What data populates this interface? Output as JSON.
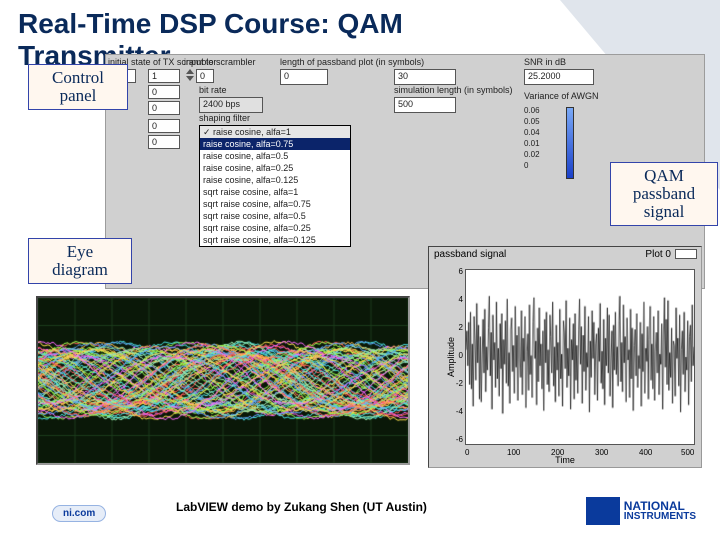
{
  "domain": "Document",
  "slide": {
    "title_line1": "Real-Time DSP Course: QAM",
    "title_line2": "Transmitter"
  },
  "annotations": {
    "control": "Control\npanel",
    "qam": "QAM\npassband\nsignal",
    "eye": "Eye\ndiagram"
  },
  "panel": {
    "headers": {
      "col1": "initial state of TX scrambler",
      "col2": "input to scrambler",
      "col3": "length of passband plot (in symbols)",
      "col4": "SNR in dB",
      "bitrate": "bit rate",
      "simlen": "simulation length (in symbols)",
      "variance": "Variance of AWGN",
      "shapingfilter": "shaping filter"
    },
    "initial_state_index": "0",
    "initial_state": [
      "1",
      "0",
      "0",
      "0",
      "0"
    ],
    "input_index": "0",
    "bit_rate_value": "2400 bps",
    "len_passband": "30",
    "sim_length": "500",
    "snr_db": "25.2000",
    "variance_values": [
      "0.06",
      "0.05",
      "0.04",
      "0.01",
      "0.02",
      "0"
    ],
    "shaping_options": [
      "raise cosine, alfa=1",
      "raise cosine, alfa=0.75",
      "raise cosine, alfa=0.5",
      "raise cosine, alfa=0.25",
      "raise cosine, alfa=0.125",
      "sqrt raise cosine, alfa=1",
      "sqrt raise cosine, alfa=0.75",
      "sqrt raise cosine, alfa=0.5",
      "sqrt raise cosine, alfa=0.25",
      "sqrt raise cosine, alfa=0.125"
    ],
    "shaping_selected_index": 1
  },
  "passband": {
    "title": "passband signal",
    "legend": "Plot 0",
    "xlabel": "Time",
    "ylabel": "Amplitude"
  },
  "chart_data": {
    "type": "line",
    "title": "passband signal",
    "xlabel": "Time",
    "ylabel": "Amplitude",
    "xlim": [
      0,
      500
    ],
    "ylim": [
      -6,
      6
    ],
    "xticks": [
      0,
      100,
      200,
      300,
      400,
      500
    ],
    "yticks": [
      -6,
      -4,
      -2,
      0,
      2,
      4,
      6
    ],
    "note": "noisy QAM passband waveform; values estimated from pixels",
    "series": [
      {
        "name": "Plot 0",
        "x_step": 2,
        "values": [
          0.5,
          1.8,
          -0.6,
          2.4,
          -1.9,
          3.1,
          -2.2,
          0.9,
          -3.4,
          2.8,
          1.1,
          -1.6,
          3.7,
          -0.4,
          2.2,
          -2.9,
          1.4,
          -3.1,
          0.2,
          2.6,
          -1.1,
          3.3,
          -2.4,
          0.7,
          -0.9,
          2.0,
          4.2,
          -1.3,
          1.7,
          -3.6,
          2.9,
          -0.2,
          1.0,
          -2.1,
          3.8,
          -1.5,
          0.6,
          -2.7,
          2.3,
          -0.8,
          3.0,
          -3.9,
          1.2,
          -0.5,
          2.5,
          -1.8,
          4.0,
          -2.0,
          0.3,
          -3.2,
          1.9,
          2.7,
          -1.0,
          0.8,
          -2.5,
          3.5,
          -0.7,
          1.5,
          -3.0,
          2.1,
          0.0,
          -1.4,
          3.2,
          -2.6,
          1.3,
          -0.3,
          2.8,
          -3.5,
          0.4,
          1.6,
          -2.3,
          3.6,
          -1.2,
          0.1,
          -2.8,
          2.4,
          4.1,
          -0.1,
          1.1,
          -3.3,
          2.0,
          -1.7,
          3.4,
          -0.6,
          0.9,
          -2.2,
          1.8,
          -3.7,
          2.6,
          -0.4,
          3.1,
          -1.9,
          0.5,
          -2.4,
          2.9,
          1.4,
          -1.1,
          3.8,
          -2.0,
          0.7,
          -3.1,
          2.2,
          -0.9,
          1.0,
          -2.7,
          3.3,
          -1.5,
          0.2,
          -3.4,
          2.5,
          1.7,
          -0.8,
          3.9,
          -2.1,
          0.6,
          -1.3,
          2.7,
          -3.6,
          1.2,
          -0.2,
          2.3,
          -2.9,
          3.0,
          -1.6,
          0.8,
          -2.5,
          1.9,
          4.0,
          -0.5,
          2.1,
          -3.2,
          1.5,
          -1.0,
          3.5,
          -2.3,
          0.3,
          -0.7,
          2.8,
          -3.8,
          1.1,
          -1.4,
          3.2,
          -0.1,
          2.4,
          -2.6,
          0.9,
          1.6,
          -3.0,
          2.0,
          -0.3,
          3.7,
          -1.8,
          0.4,
          -2.2,
          2.6,
          -3.3,
          1.3,
          -0.6,
          3.4,
          -1.1,
          2.9,
          -2.7,
          0.0,
          1.8,
          -3.5,
          2.2,
          -0.9,
          3.1,
          -1.2,
          0.7,
          -2.0,
          2.5,
          4.2,
          -1.7,
          1.0,
          -2.4,
          3.6,
          -0.4,
          1.4,
          -3.1,
          2.7,
          -0.2,
          0.5,
          -2.8,
          3.3,
          -1.5,
          2.0,
          -3.7,
          0.8,
          1.9,
          -1.3,
          3.0,
          -2.1,
          0.1,
          -0.8,
          2.4,
          -3.4,
          1.6,
          -1.0,
          3.8,
          -2.5,
          0.6,
          -0.3,
          2.1,
          -2.9,
          1.2,
          3.5,
          -1.6,
          0.9,
          -2.2,
          2.8,
          -3.0,
          0.4,
          1.7,
          -1.1,
          3.2,
          -2.6,
          0.2,
          -0.5,
          2.3,
          -3.6,
          1.5,
          4.1,
          -0.7,
          2.6,
          -1.9,
          3.9,
          -2.3,
          0.3,
          -1.4,
          2.0,
          -3.2,
          1.1,
          0.8,
          -2.7,
          3.4,
          -0.1,
          1.3,
          -2.0,
          2.9,
          -3.8,
          0.5,
          1.8,
          -1.2,
          3.1,
          -2.4,
          0.0,
          -0.9,
          2.5,
          -3.3,
          1.4,
          2.2,
          -1.7,
          3.6,
          -0.6,
          0.7
        ]
      }
    ]
  },
  "footer": {
    "credit": "LabVIEW demo by Zukang Shen (UT Austin)",
    "nicom": "ni.com",
    "logo_top": "NATIONAL",
    "logo_bottom": "INSTRUMENTS"
  }
}
